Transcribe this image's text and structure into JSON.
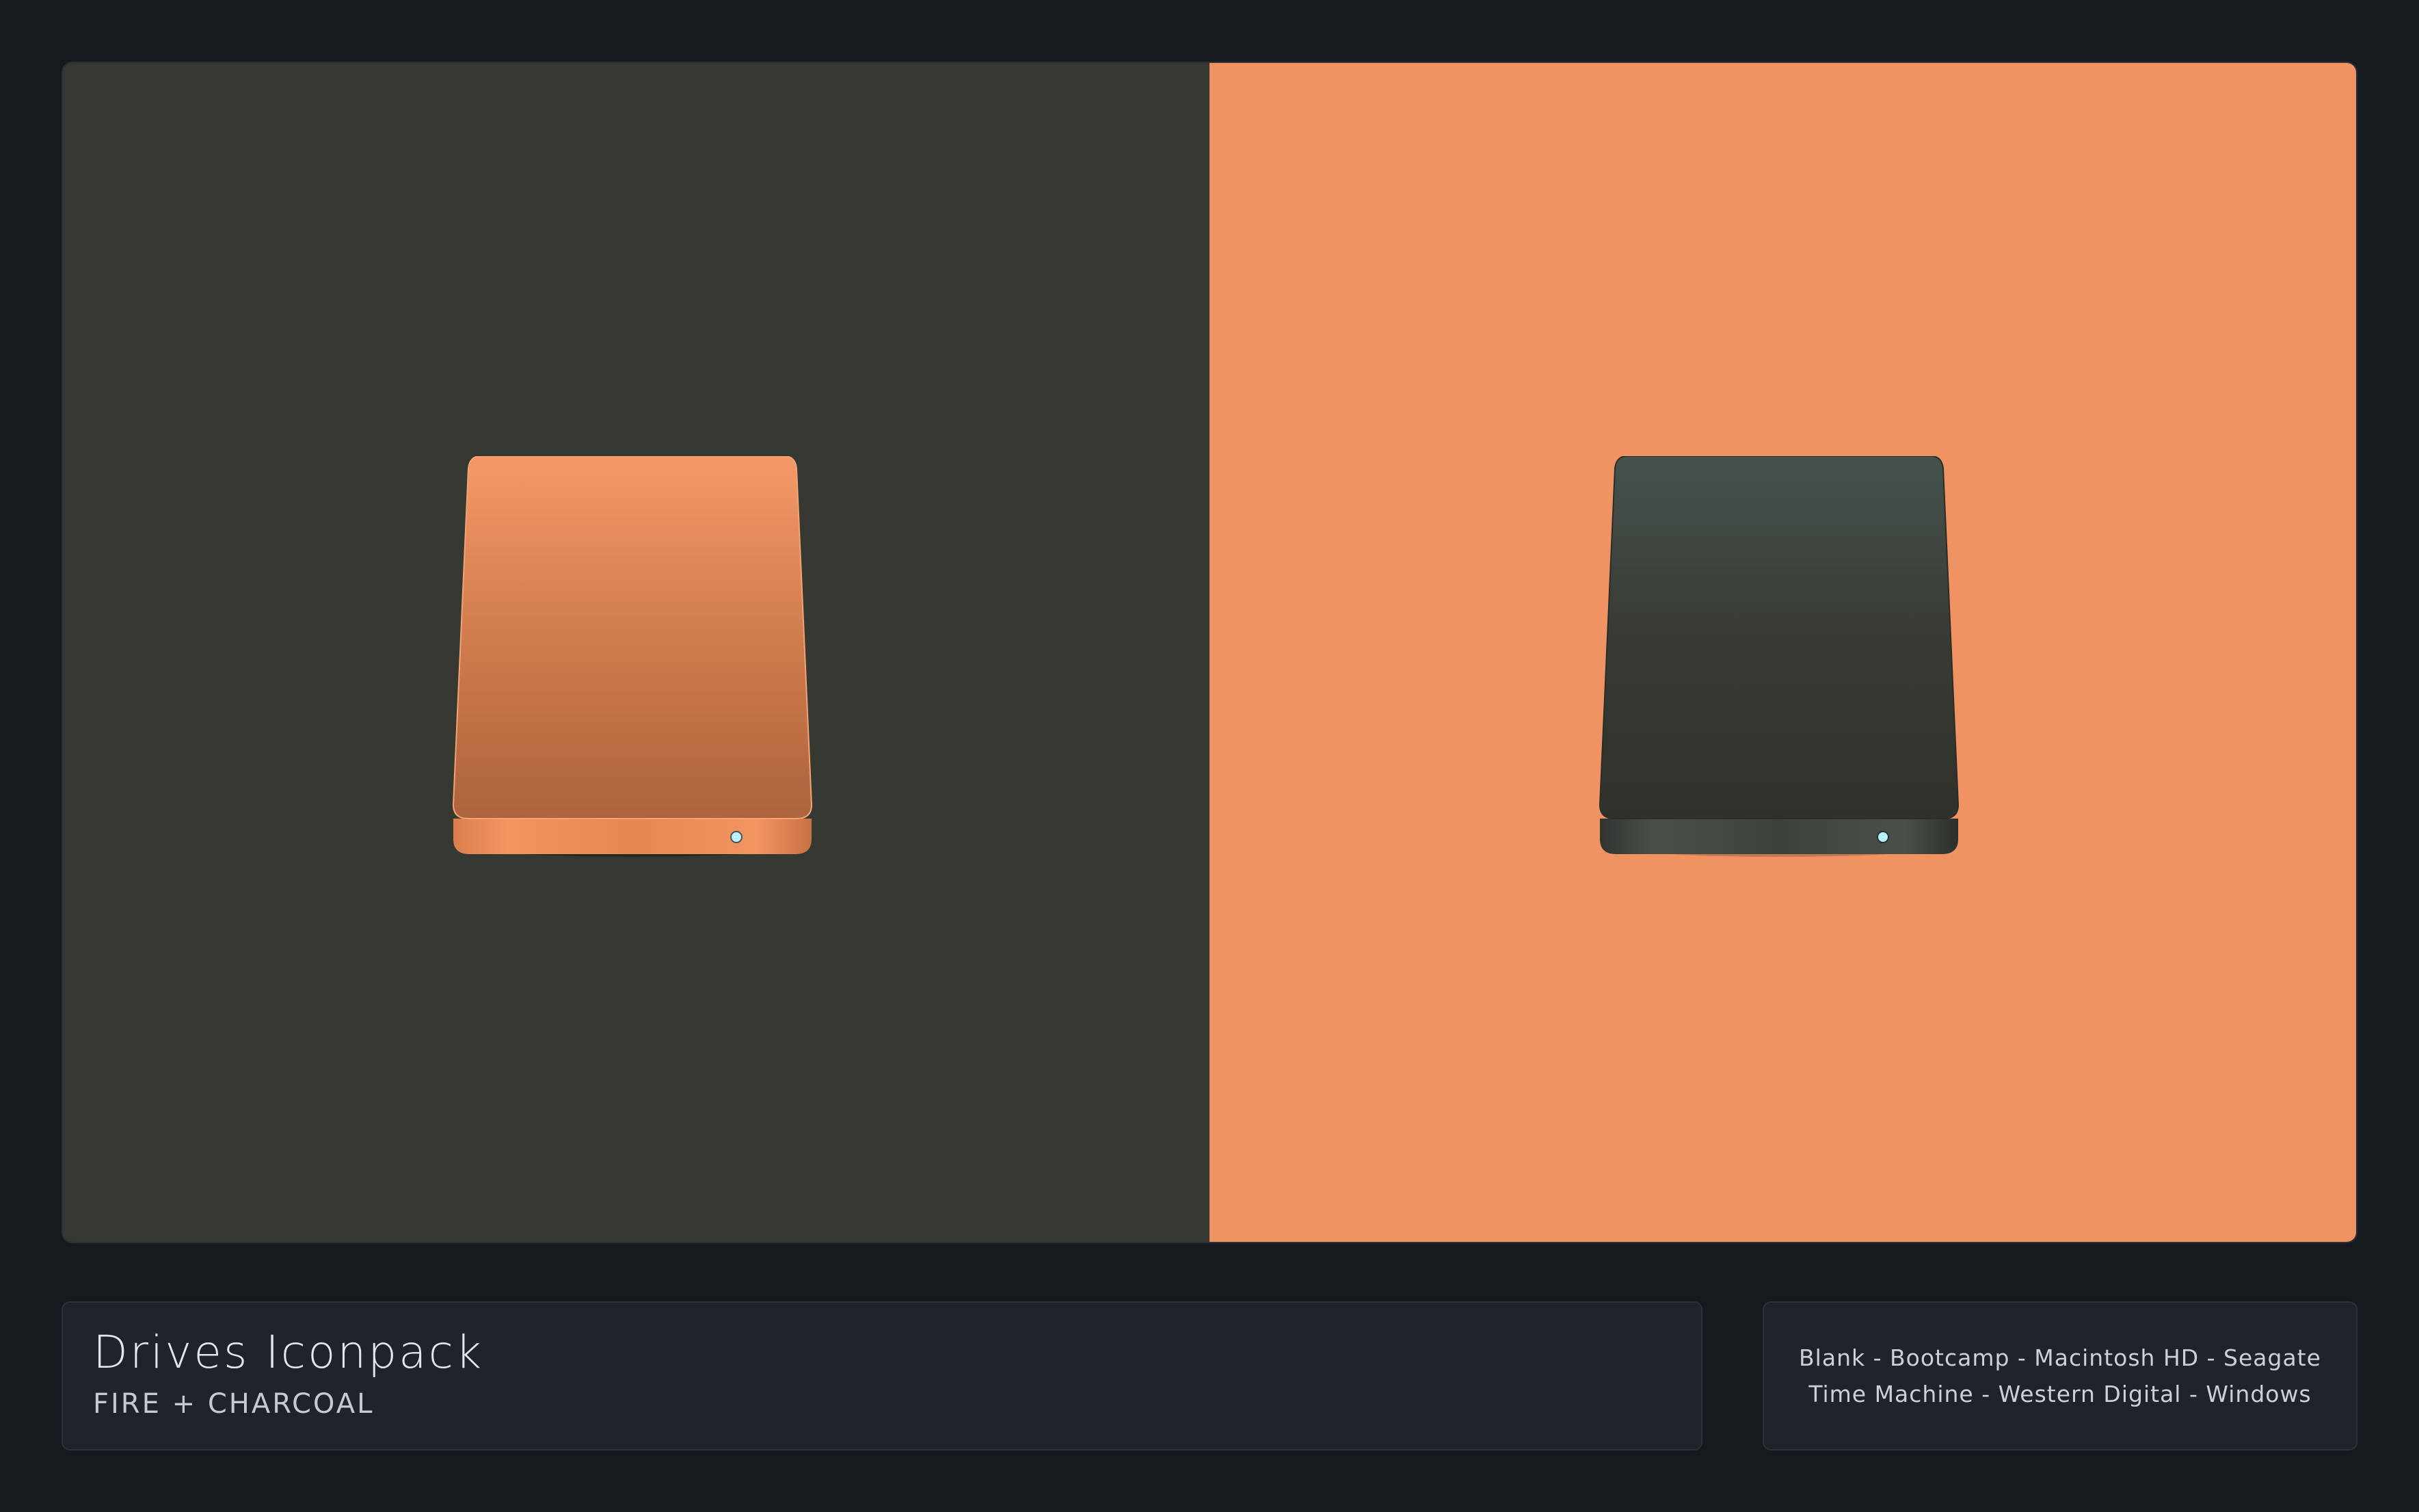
{
  "showcase": {
    "left_background": "#363832",
    "right_background": "#ef9363",
    "left_drive": {
      "icon": "hard-drive-icon",
      "variant": "fire",
      "color": "#e8874f"
    },
    "right_drive": {
      "icon": "hard-drive-icon",
      "variant": "charcoal",
      "color": "#3a3e38"
    }
  },
  "info": {
    "title": "Drives Iconpack",
    "subtitle": "FIRE + CHARCOAL"
  },
  "drive_list": {
    "line1": "Blank - Bootcamp - Macintosh HD - Seagate",
    "line2": "Time Machine - Western Digital - Windows"
  }
}
